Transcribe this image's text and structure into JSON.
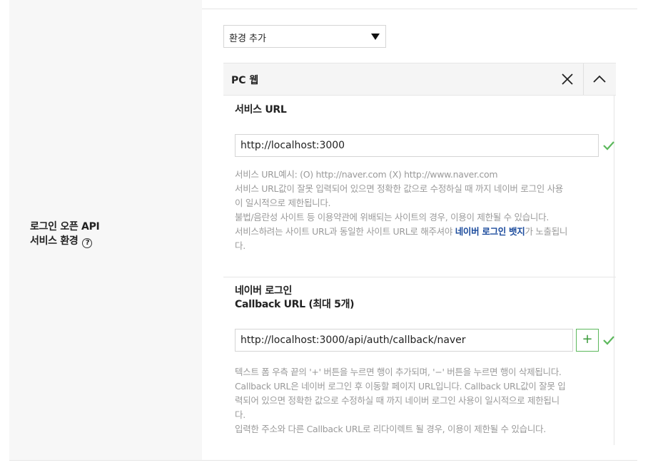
{
  "label": {
    "line1": "로그인 오픈 API",
    "line2": "서비스 환경",
    "help_glyph": "?"
  },
  "env_select": {
    "value": "환경 추가"
  },
  "panel": {
    "title": "PC 웹"
  },
  "service_url": {
    "title": "서비스 URL",
    "value": "http://localhost:3000",
    "help": {
      "line1": "서비스 URL예시: (O) http://naver.com (X) http://www.naver.com",
      "line2": "서비스 URL값이 잘못 입력되어 있으면 정확한 값으로 수정하실 때 까지 네이버 로그인 사용",
      "line3": "이 일시적으로 제한됩니다.",
      "line4": "불법/음란성 사이트 등 이용약관에 위배되는 사이트의 경우, 이용이 제한될 수 있습니다.",
      "line5_pre": "서비스하려는 사이트 URL과 동일한 사이트 URL로 해주셔야 ",
      "line5_link": "네이버 로그인 뱃지",
      "line5_post": "가 노출됩니",
      "line6": "다."
    }
  },
  "callback_url": {
    "title_line1": "네이버 로그인",
    "title_line2": "Callback URL (최대 5개)",
    "value": "http://localhost:3000/api/auth/callback/naver",
    "add_glyph": "+",
    "help": {
      "line1": "텍스트 폼 우측 끝의 '+' 버튼을 누르면 행이 추가되며, '−' 버튼을 누르면 행이 삭제됩니다.",
      "line2": "Callback URL은 네이버 로그인 후 이동할 페이지 URL입니다. Callback URL값이 잘못 입",
      "line3": "력되어 있으면 정확한 값으로 수정하실 때 까지 네이버 로그인 사용이 일시적으로 제한됩니",
      "line4": "다.",
      "line5": "입력한 주소와 다른 Callback URL로 리다이렉트 될 경우, 이용이 제한될 수 있습니다."
    }
  },
  "colors": {
    "accent_green": "#5cb85c",
    "link_blue": "#1a4a9c",
    "help_gray": "#9a9a9a"
  }
}
